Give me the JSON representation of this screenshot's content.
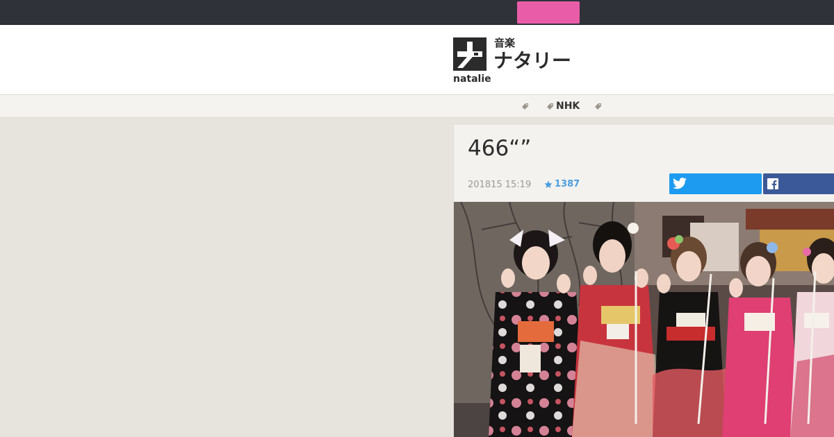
{
  "topbar": {
    "accent_color": "#e95da8"
  },
  "header": {
    "logo": {
      "mark_icon": "natalie-logo-icon",
      "subtitle": "音楽",
      "title": "ナタリー",
      "wordmark": "natalie"
    }
  },
  "tags": [
    {
      "label": "",
      "icon": "tag-icon"
    },
    {
      "label": "NHK",
      "icon": "tag-icon"
    },
    {
      "label": "",
      "icon": "tag-icon"
    }
  ],
  "article": {
    "title": "466“”",
    "date": "201815 15:19",
    "stars": "1387",
    "star_icon": "star-icon",
    "share": {
      "twitter_icon": "twitter-icon",
      "facebook_icon": "facebook-icon",
      "twitter_color": "#1d9bf0",
      "facebook_color": "#3b5998"
    },
    "photo_alt": "photo"
  }
}
